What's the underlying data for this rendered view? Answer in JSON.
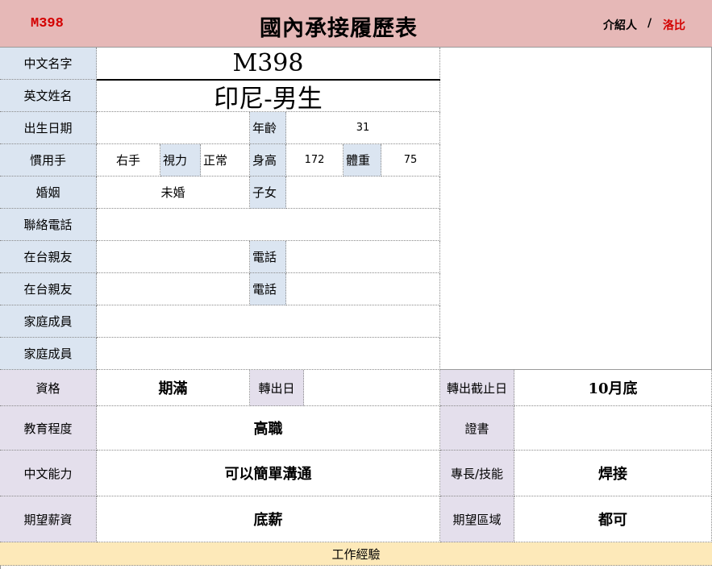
{
  "header": {
    "id": "M398",
    "title": "國內承接履歷表",
    "introducer_label": "介紹人",
    "separator": "/",
    "introducer_value": "洛比"
  },
  "fields": {
    "chinese_name_label": "中文名字",
    "chinese_name_value": "M398",
    "english_name_label": "英文姓名",
    "english_name_value": "印尼-男生",
    "birth_label": "出生日期",
    "birth_value": "",
    "age_label": "年齡",
    "age_value": "31",
    "hand_label": "慣用手",
    "hand_value": "右手",
    "vision_label": "視力",
    "vision_value": "正常",
    "height_label": "身高",
    "height_value": "172",
    "weight_label": "體重",
    "weight_value": "75",
    "marriage_label": "婚姻",
    "marriage_value": "未婚",
    "children_label": "子女",
    "children_value": "",
    "phone_label": "聯絡電話",
    "relative1_label": "在台親友",
    "relative1_phone_label": "電話",
    "relative2_label": "在台親友",
    "relative2_phone_label": "電話",
    "family1_label": "家庭成員",
    "family2_label": "家庭成員",
    "qualification_label": "資格",
    "qualification_value": "期滿",
    "transfer_date_label": "轉出日",
    "transfer_date_value": "",
    "transfer_deadline_label": "轉出截止日",
    "transfer_deadline_value": "10月底",
    "education_label": "教育程度",
    "education_value": "高職",
    "certificate_label": "證書",
    "certificate_value": "",
    "chinese_ability_label": "中文能力",
    "chinese_ability_value": "可以簡單溝通",
    "skill_label": "專長/技能",
    "skill_value": "焊接",
    "salary_label": "期望薪資",
    "salary_value": "底薪",
    "region_label": "期望區域",
    "region_value": "都可"
  },
  "footer": {
    "work_experience_label": "工作經驗"
  },
  "colors": {
    "header_bg": "#e6b8b7",
    "label_blue": "#dbe5f1",
    "label_purple": "#e4dfec",
    "footer_bg": "#fde9b9",
    "accent_red": "#d40000"
  }
}
